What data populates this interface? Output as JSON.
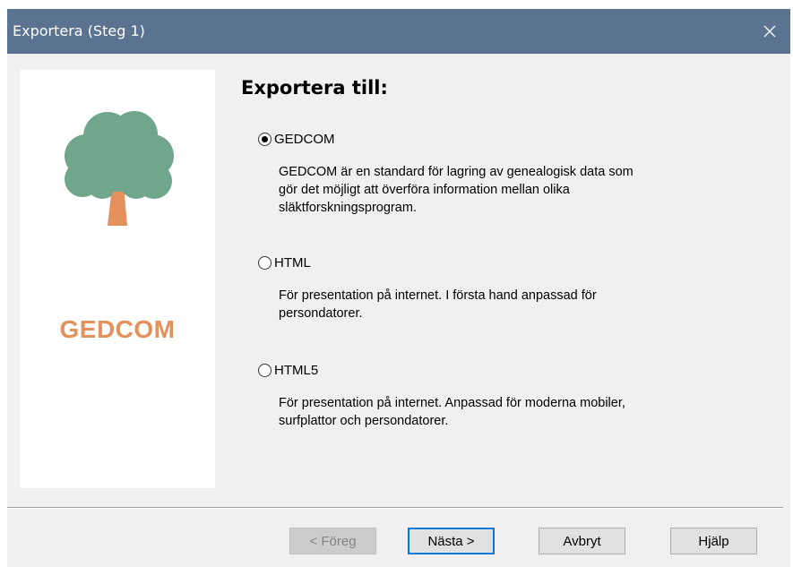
{
  "window": {
    "title": "Exportera (Steg 1)",
    "close_icon": "close-icon"
  },
  "colors": {
    "titlebar": "#5a7390",
    "brand": "#e5915c",
    "tree_canopy": "#6fa68c",
    "tree_trunk": "#e5915c",
    "default_button_border": "#0078d7"
  },
  "left_panel": {
    "logo_icon": "tree-icon",
    "brand": "GEDCOM"
  },
  "main": {
    "heading": "Exportera till:",
    "selected": "GEDCOM",
    "options": [
      {
        "label": "GEDCOM",
        "checked": true,
        "description": [
          "GEDCOM är en standard för lagring av genealogisk data som",
          "gör det möjligt att överföra information mellan olika",
          "släktforskningsprogram."
        ]
      },
      {
        "label": "HTML",
        "checked": false,
        "description": [
          "För presentation på internet. I första hand anpassad för",
          "persondatorer."
        ]
      },
      {
        "label": "HTML5",
        "checked": false,
        "description": [
          "För presentation på internet. Anpassad för moderna mobiler,",
          "surfplattor och persondatorer."
        ]
      }
    ]
  },
  "buttons": {
    "back": "< Föreg",
    "next": "Nästa >",
    "cancel": "Avbryt",
    "help": "Hjälp"
  }
}
